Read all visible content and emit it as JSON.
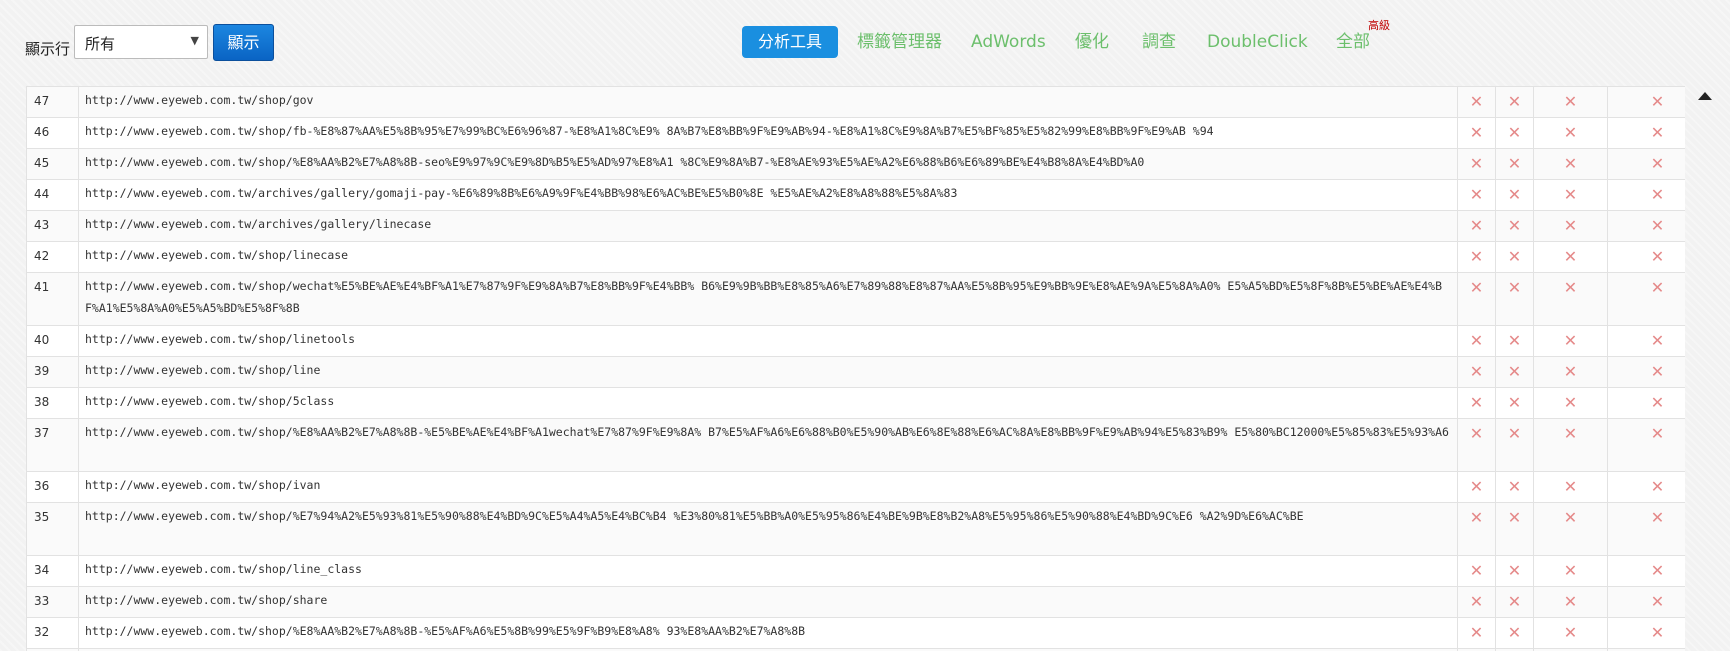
{
  "controls": {
    "rows_label": "顯示行",
    "select_value": "所有",
    "show_button": "顯示"
  },
  "nav": [
    {
      "label": "分析工具",
      "active": true
    },
    {
      "label": "標籤管理器"
    },
    {
      "label": "AdWords"
    },
    {
      "label": "優化"
    },
    {
      "label": "調查"
    },
    {
      "label": "DoubleClick"
    },
    {
      "label": "全部",
      "badge": "高級"
    }
  ],
  "mark": "✕",
  "rows": [
    {
      "num": "47",
      "url": "http://www.eyeweb.com.tw/shop/gov"
    },
    {
      "num": "46",
      "url": "http://www.eyeweb.com.tw/shop/fb-%E8%87%AA%E5%8B%95%E7%99%BC%E6%96%87-%E8%A1%8C%E9% 8A%B7%E8%BB%9F%E9%AB%94-%E8%A1%8C%E9%8A%B7%E5%BF%85%E5%82%99%E8%BB%9F%E9%AB %94"
    },
    {
      "num": "45",
      "url": "http://www.eyeweb.com.tw/shop/%E8%AA%B2%E7%A8%8B-seo%E9%97%9C%E9%8D%B5%E5%AD%97%E8%A1 %8C%E9%8A%B7-%E8%AE%93%E5%AE%A2%E6%88%B6%E6%89%BE%E4%B8%8A%E4%BD%A0"
    },
    {
      "num": "44",
      "url": "http://www.eyeweb.com.tw/archives/gallery/gomaji-pay-%E6%89%8B%E6%A9%9F%E4%BB%98%E6%AC%BE%E5%B0%8E %E5%AE%A2%E8%A8%88%E5%8A%83"
    },
    {
      "num": "43",
      "url": "http://www.eyeweb.com.tw/archives/gallery/linecase"
    },
    {
      "num": "42",
      "url": "http://www.eyeweb.com.tw/shop/linecase"
    },
    {
      "num": "41",
      "url": "http://www.eyeweb.com.tw/shop/wechat%E5%BE%AE%E4%BF%A1%E7%87%9F%E9%8A%B7%E8%BB%9F%E4%BB% B6%E9%9B%BB%E8%85%A6%E7%89%88%E8%87%AA%E5%8B%95%E9%BB%9E%E8%AE%9A%E5%8A%A0% E5%A5%BD%E5%8F%8B%E5%BE%AE%E4%BF%A1%E5%8A%A0%E5%A5%BD%E5%8F%8B",
      "tall": true
    },
    {
      "num": "40",
      "url": "http://www.eyeweb.com.tw/shop/linetools"
    },
    {
      "num": "39",
      "url": "http://www.eyeweb.com.tw/shop/line"
    },
    {
      "num": "38",
      "url": "http://www.eyeweb.com.tw/shop/5class"
    },
    {
      "num": "37",
      "url": "http://www.eyeweb.com.tw/shop/%E8%AA%B2%E7%A8%8B-%E5%BE%AE%E4%BF%A1wechat%E7%87%9F%E9%8A% B7%E5%AF%A6%E6%88%B0%E5%90%AB%E6%8E%88%E6%AC%8A%E8%BB%9F%E9%AB%94%E5%83%B9% E5%80%BC12000%E5%85%83%E5%93%A6",
      "tall": true
    },
    {
      "num": "36",
      "url": "http://www.eyeweb.com.tw/shop/ivan"
    },
    {
      "num": "35",
      "url": "http://www.eyeweb.com.tw/shop/%E7%94%A2%E5%93%81%E5%90%88%E4%BD%9C%E5%A4%A5%E4%BC%B4 %E3%80%81%E5%BB%A0%E5%95%86%E4%BE%9B%E8%B2%A8%E5%95%86%E5%90%88%E4%BD%9C%E6 %A2%9D%E6%AC%BE",
      "tall": true
    },
    {
      "num": "34",
      "url": "http://www.eyeweb.com.tw/shop/line_class"
    },
    {
      "num": "33",
      "url": "http://www.eyeweb.com.tw/shop/share"
    },
    {
      "num": "32",
      "url": "http://www.eyeweb.com.tw/shop/%E8%AA%B2%E7%A8%8B-%E5%AF%A6%E5%8B%99%E5%9F%B9%E8%A8% 93%E8%AA%B2%E7%A8%8B"
    },
    {
      "num": "",
      "url": ""
    }
  ]
}
